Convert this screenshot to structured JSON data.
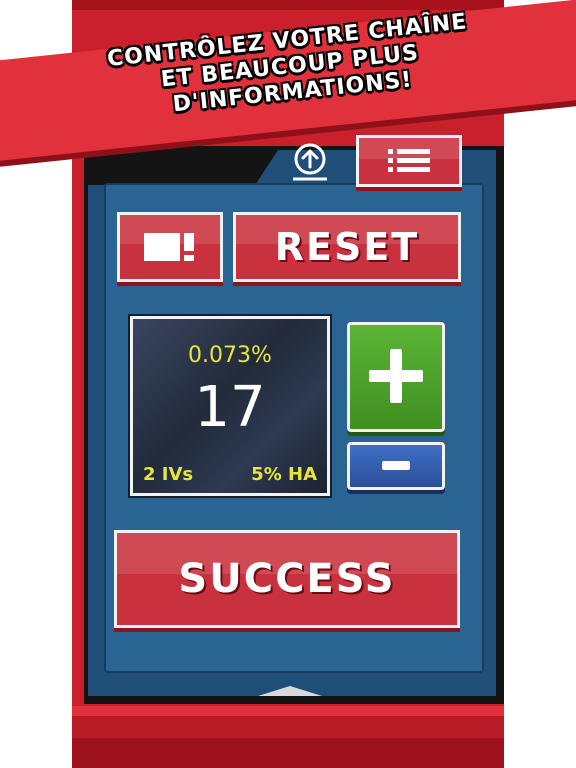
{
  "banner": {
    "line1": "CONTRÔLEZ VOTRE CHAÎNE",
    "line2": "ET BEAUCOUP PLUS",
    "line3": "D'INFORMATIONS!"
  },
  "toolbar": {
    "upload_icon": "upload-circle-icon",
    "menu_icon": "list-menu-icon",
    "layout_icon": "panel-layout-icon"
  },
  "buttons": {
    "reset_label": "RESET",
    "success_label": "SUCCESS"
  },
  "counter": {
    "probability": "0.073%",
    "count": "17",
    "ivs": "2 IVs",
    "hidden_ability": "5% HA"
  },
  "colors": {
    "device_red": "#c9202c",
    "screen_blue": "#2a6493",
    "button_red": "#c9313e",
    "plus_green": "#4ea52c",
    "minus_blue": "#3660b0",
    "accent_yellow": "#e8e638"
  }
}
